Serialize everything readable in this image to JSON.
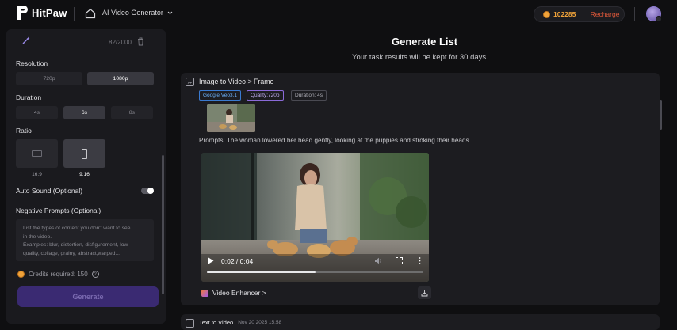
{
  "header": {
    "brand": "HitPaw",
    "app_title": "AI Video Generator",
    "credits_balance": "102285",
    "separator": "|",
    "recharge_label": "Recharge"
  },
  "left_panel": {
    "char_count": "82/2000",
    "resolution": {
      "label": "Resolution",
      "options": [
        "720p",
        "1080p"
      ],
      "selected": "1080p"
    },
    "duration": {
      "label": "Duration",
      "options": [
        "4s",
        "6s",
        "8s"
      ],
      "selected": "6s"
    },
    "ratio": {
      "label": "Ratio",
      "options": [
        "16:9",
        "9:16"
      ],
      "selected": "9:16"
    },
    "auto_sound": {
      "label": "Auto Sound (Optional)",
      "enabled": false
    },
    "negative_prompts": {
      "label": "Negative Prompts (Optional)",
      "placeholder_lines": [
        "List the types of content you don't want to see",
        "in the video.",
        "Examples: blur, distortion, disfigurement, low",
        "quality, collage, grainy,  abstract,warped..."
      ]
    },
    "credits_required": "Credits required: 150",
    "info_symbol": "?",
    "generate_label": "Generate"
  },
  "main": {
    "title": "Generate List",
    "subtitle": "Your task results will be kept for 30 days.",
    "task1": {
      "title": "Image to Video > Frame",
      "tags": {
        "model": "Google Veo3.1",
        "quality": "Quality:720p",
        "duration": "Duration: 4s"
      },
      "prompt": "Prompts: The woman lowered her head gently, looking at the puppies and stroking their heads",
      "video_time": "0:02 / 0:04",
      "video_progress": 0.5,
      "enhancer_label": "Video Enhancer >"
    },
    "task2": {
      "title": "Text to Video",
      "date": "Nov 20 2025 15:58"
    }
  },
  "colors": {
    "accent_purple": "#3a2a72",
    "credit_orange": "#f0a33a",
    "recharge_red": "#e0593a"
  }
}
